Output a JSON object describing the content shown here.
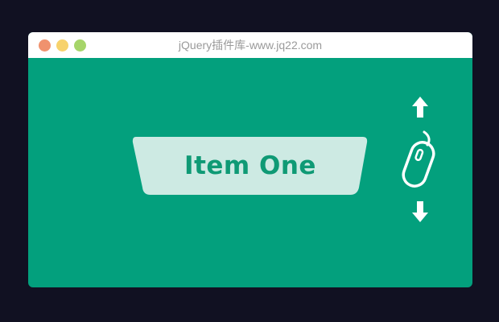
{
  "window": {
    "title": "jQuery插件库-www.jq22.com",
    "controls": {
      "close_color": "#f0926e",
      "minimize_color": "#f7d26c",
      "zoom_color": "#a6d56a"
    }
  },
  "colors": {
    "background": "#111122",
    "content": "#03a07d",
    "card": "#cdeae3",
    "card_text": "#0f9a75"
  },
  "main": {
    "item_label": "Item One"
  },
  "scroll_hint": {
    "icons": [
      "arrow-up-icon",
      "mouse-icon",
      "arrow-down-icon"
    ]
  }
}
